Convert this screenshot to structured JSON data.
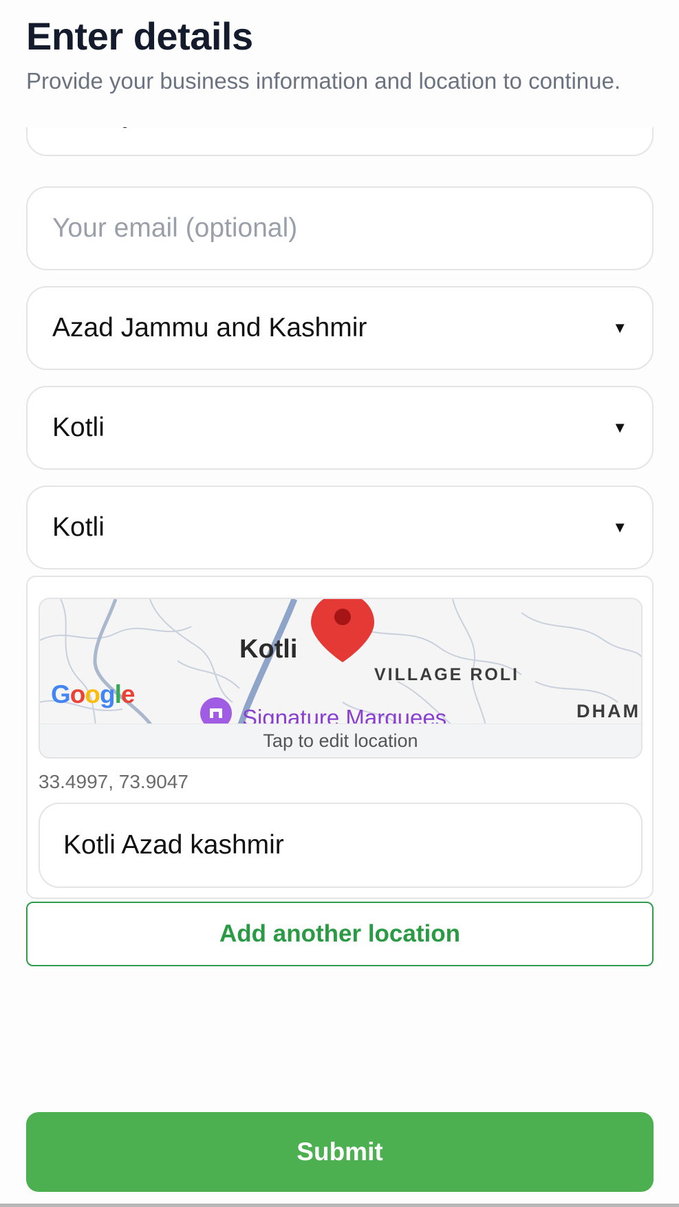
{
  "header": {
    "title": "Enter details",
    "subtitle": "Provide your business information and location to continue."
  },
  "form": {
    "business_type_value": "Poultry Wholesaler",
    "email_placeholder": "Your email (optional)",
    "province_value": "Azad Jammu and Kashmir",
    "district_value": "Kotli",
    "city_value": "Kotli",
    "dropdown_icon": "▼"
  },
  "location": {
    "map_labels": {
      "city": "Kotli",
      "village": "VILLAGE ROLI",
      "area": "DHAM",
      "poi": "Signature Marquees",
      "attribution": "Google"
    },
    "edit_hint": "Tap to edit location",
    "coordinates": "33.4997, 73.9047",
    "address_value": "Kotli Azad kashmir",
    "pin_color": "#e53935"
  },
  "actions": {
    "add_location_label": "Add another location",
    "submit_label": "Submit"
  },
  "colors": {
    "primary_green": "#4caf50",
    "outline_green": "#2e9c4c"
  }
}
